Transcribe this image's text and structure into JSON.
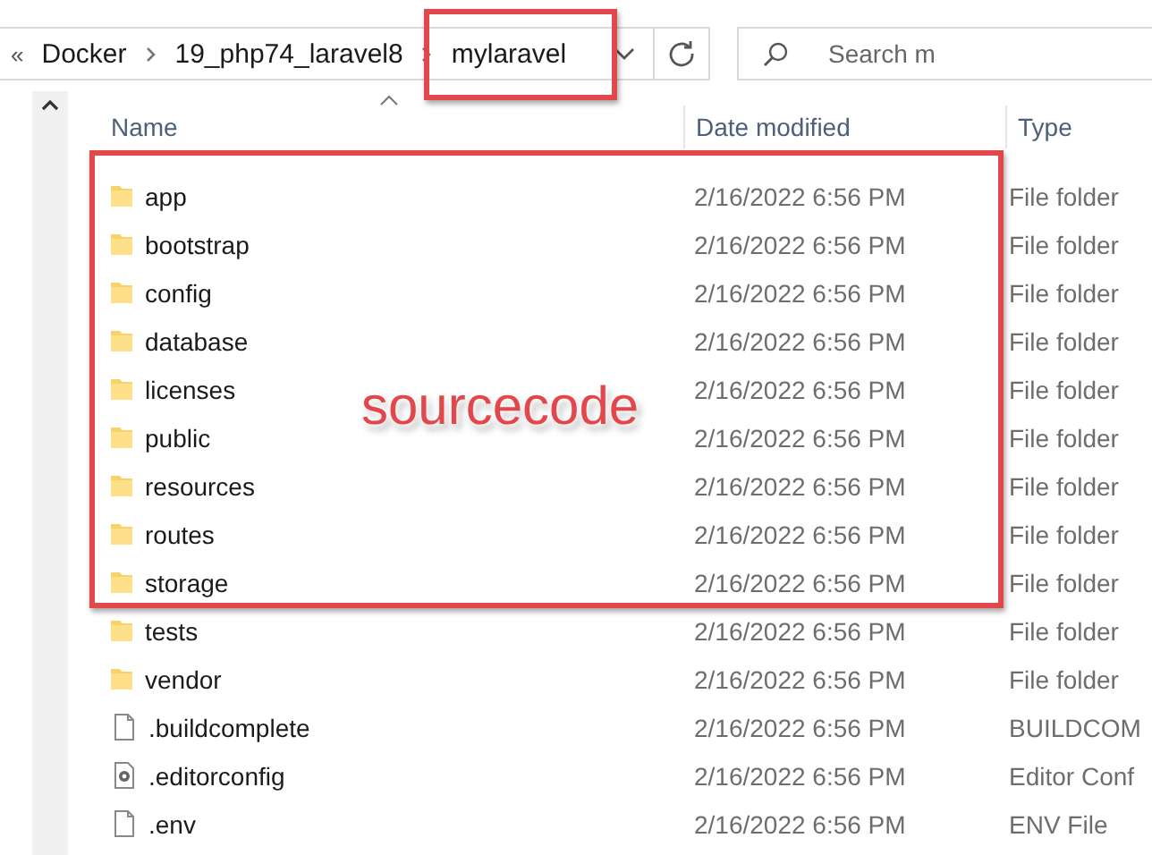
{
  "address_bar": {
    "overflow": "«",
    "crumbs": [
      "Docker",
      "19_php74_laravel8",
      "mylaravel"
    ]
  },
  "search": {
    "placeholder": "Search m"
  },
  "columns": [
    "Name",
    "Date modified",
    "Type"
  ],
  "rows": [
    {
      "name": "app",
      "date": "2/16/2022 6:56 PM",
      "type": "File folder",
      "kind": "folder"
    },
    {
      "name": "bootstrap",
      "date": "2/16/2022 6:56 PM",
      "type": "File folder",
      "kind": "folder"
    },
    {
      "name": "config",
      "date": "2/16/2022 6:56 PM",
      "type": "File folder",
      "kind": "folder"
    },
    {
      "name": "database",
      "date": "2/16/2022 6:56 PM",
      "type": "File folder",
      "kind": "folder"
    },
    {
      "name": "licenses",
      "date": "2/16/2022 6:56 PM",
      "type": "File folder",
      "kind": "folder"
    },
    {
      "name": "public",
      "date": "2/16/2022 6:56 PM",
      "type": "File folder",
      "kind": "folder"
    },
    {
      "name": "resources",
      "date": "2/16/2022 6:56 PM",
      "type": "File folder",
      "kind": "folder"
    },
    {
      "name": "routes",
      "date": "2/16/2022 6:56 PM",
      "type": "File folder",
      "kind": "folder"
    },
    {
      "name": "storage",
      "date": "2/16/2022 6:56 PM",
      "type": "File folder",
      "kind": "folder"
    },
    {
      "name": "tests",
      "date": "2/16/2022 6:56 PM",
      "type": "File folder",
      "kind": "folder"
    },
    {
      "name": "vendor",
      "date": "2/16/2022 6:56 PM",
      "type": "File folder",
      "kind": "folder"
    },
    {
      "name": ".buildcomplete",
      "date": "2/16/2022 6:56 PM",
      "type": "BUILDCOM",
      "kind": "file"
    },
    {
      "name": ".editorconfig",
      "date": "2/16/2022 6:56 PM",
      "type": "Editor Conf",
      "kind": "config"
    },
    {
      "name": ".env",
      "date": "2/16/2022 6:56 PM",
      "type": "ENV File",
      "kind": "file"
    }
  ],
  "annotation": {
    "label": "sourcecode"
  }
}
